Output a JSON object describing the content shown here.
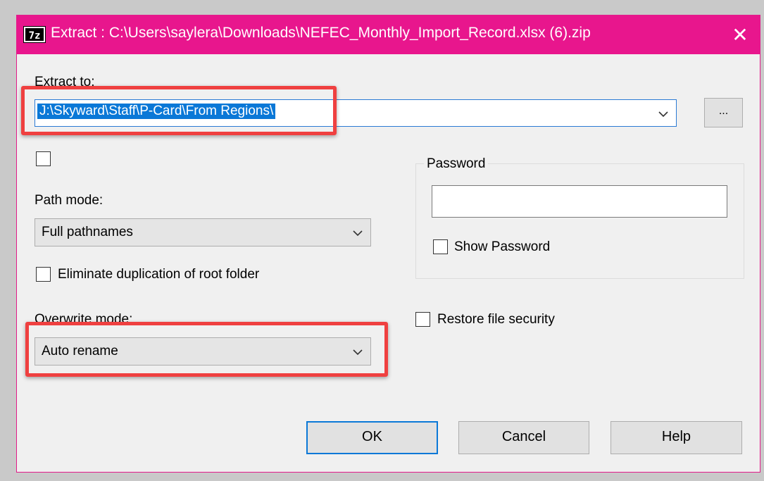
{
  "window": {
    "icon_text": "7z",
    "title": "Extract : C:\\Users\\saylera\\Downloads\\NEFEC_Monthly_Import_Record.xlsx (6).zip",
    "close_glyph": "✕"
  },
  "extract_to": {
    "label": "Extract to:",
    "value": "J:\\Skyward\\Staff\\P-Card\\From Regions\\",
    "browse_label": "..."
  },
  "path_mode": {
    "label": "Path mode:",
    "selected": "Full pathnames"
  },
  "eliminate_duplication": {
    "label": "Eliminate duplication of root folder",
    "checked": false
  },
  "overwrite_mode": {
    "label": "Overwrite mode:",
    "selected": "Auto rename"
  },
  "password": {
    "group_label": "Password",
    "value": "",
    "show_password_label": "Show Password",
    "show_password_checked": false
  },
  "restore_security": {
    "label": "Restore file security",
    "checked": false
  },
  "buttons": {
    "ok": "OK",
    "cancel": "Cancel",
    "help": "Help"
  },
  "colors": {
    "titlebar": "#e8168d",
    "highlight": "#ef4040",
    "selection": "#0a78d7",
    "default_button_border": "#0a78d7"
  }
}
